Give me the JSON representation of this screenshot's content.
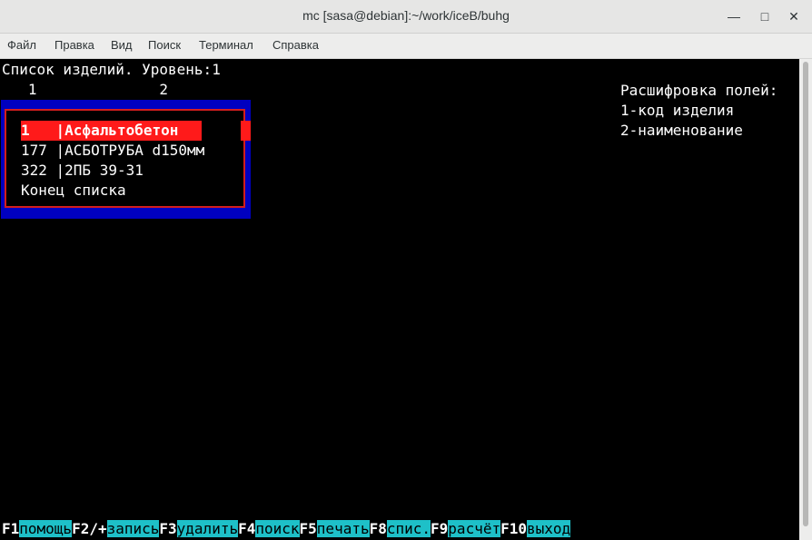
{
  "window": {
    "title": "mc [sasa@debian]:~/work/iceB/buhg",
    "minimize_glyph": "—",
    "maximize_glyph": "□",
    "close_glyph": "✕"
  },
  "menu": [
    "Файл",
    "Правка",
    "Вид",
    "Поиск",
    "Терминал",
    "Справка"
  ],
  "screen": {
    "header": "Список изделий. Уровень:1",
    "col_numbers": "   1              2",
    "legend_title": "Расшифровка полей:",
    "legend_lines": [
      "1-код изделия",
      "2-наименование"
    ]
  },
  "list": {
    "rows": [
      {
        "code": "1   ",
        "name": "|Асфальтобетон"
      },
      {
        "code": "177 ",
        "name": "|АСБОТРУБА d150мм"
      },
      {
        "code": "322 ",
        "name": "|2ПБ 39-31"
      }
    ],
    "end_text": "Конец списка"
  },
  "fkeys": [
    {
      "key": "F1",
      "label": "помощь"
    },
    {
      "key": "F2/+",
      "label": "запись"
    },
    {
      "key": "F3",
      "label": "удалить"
    },
    {
      "key": "F4",
      "label": "поиск"
    },
    {
      "key": "F5",
      "label": "печать"
    },
    {
      "key": "F8",
      "label": "спис."
    },
    {
      "key": "F9",
      "label": "расчёт"
    },
    {
      "key": "F10",
      "label": "выход"
    }
  ],
  "colors": {
    "terminal_bg": "#000000",
    "box_blue": "#0000c0",
    "highlight_red": "#ff1a1a",
    "fkey_cyan": "#1ec0c8"
  }
}
